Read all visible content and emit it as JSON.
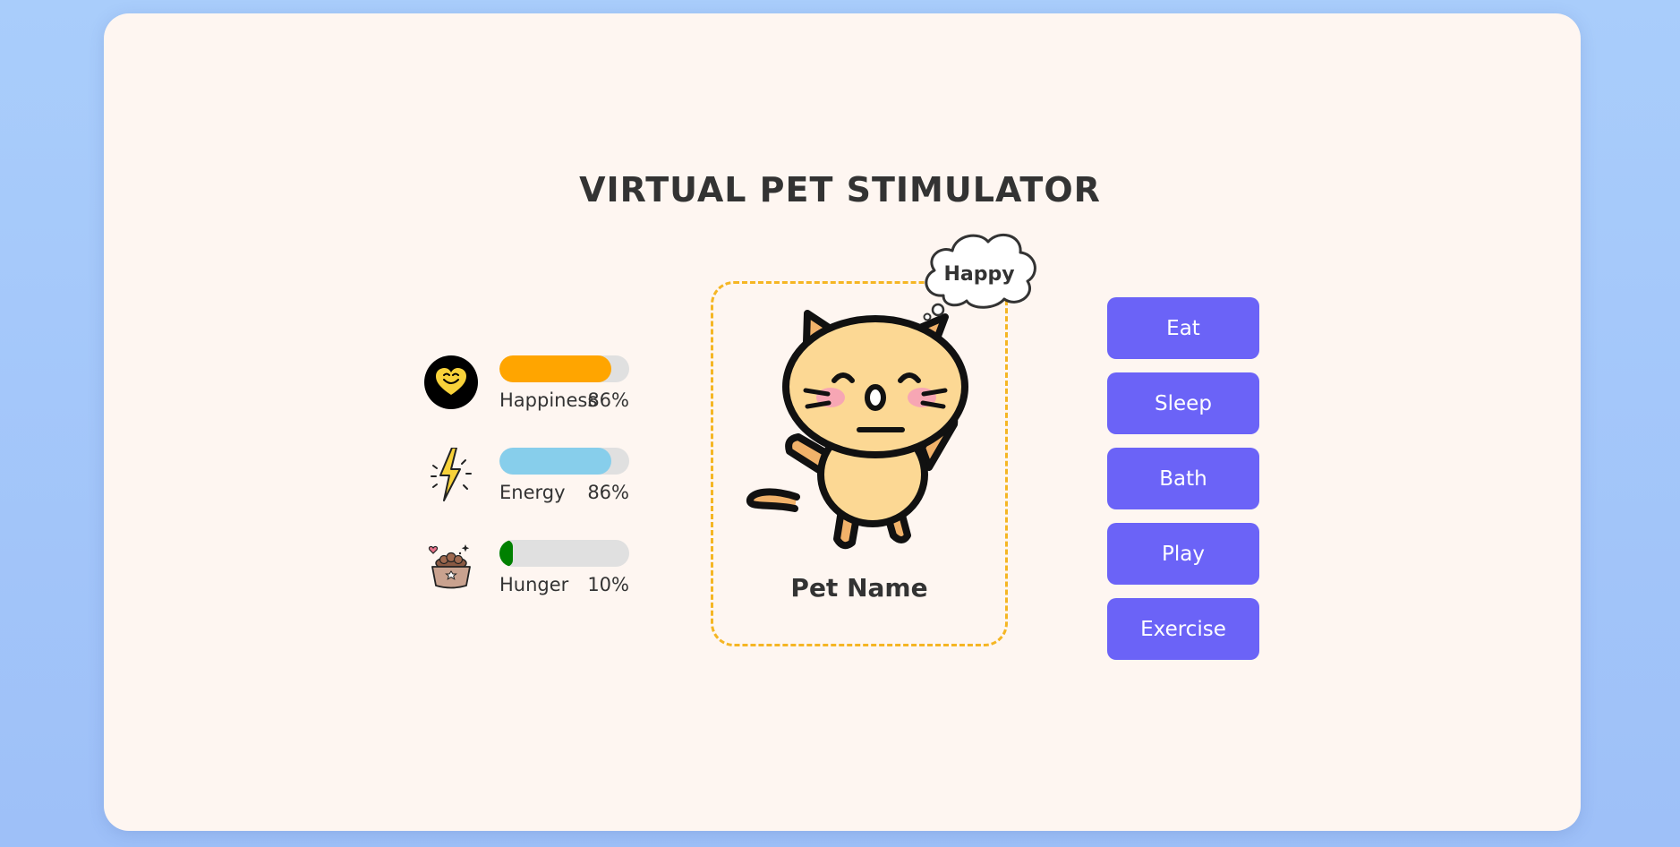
{
  "app": {
    "title": "VIRTUAL PET STIMULATOR"
  },
  "stats": [
    {
      "label": "Happiness",
      "value": "86%",
      "level": 0.86,
      "color": "#ffa500",
      "icon": "smiling-heart-icon"
    },
    {
      "label": "Energy",
      "value": "86%",
      "level": 0.86,
      "color": "#87ceeb",
      "icon": "lightning-bolt-icon"
    },
    {
      "label": "Hunger",
      "value": "10%",
      "level": 0.1,
      "color": "#008000",
      "icon": "pet-food-bowl-icon"
    }
  ],
  "pet": {
    "name": "Pet Name",
    "mood": "Happy",
    "icon": "cat-icon"
  },
  "actions": [
    {
      "label": "Eat"
    },
    {
      "label": "Sleep"
    },
    {
      "label": "Bath"
    },
    {
      "label": "Play"
    },
    {
      "label": "Exercise"
    }
  ],
  "colors": {
    "background": "#a9cdfb",
    "card": "#fef6f1",
    "button": "#6b63f7",
    "pet_border": "#f5b624",
    "bar_track": "#e0e0e0"
  }
}
